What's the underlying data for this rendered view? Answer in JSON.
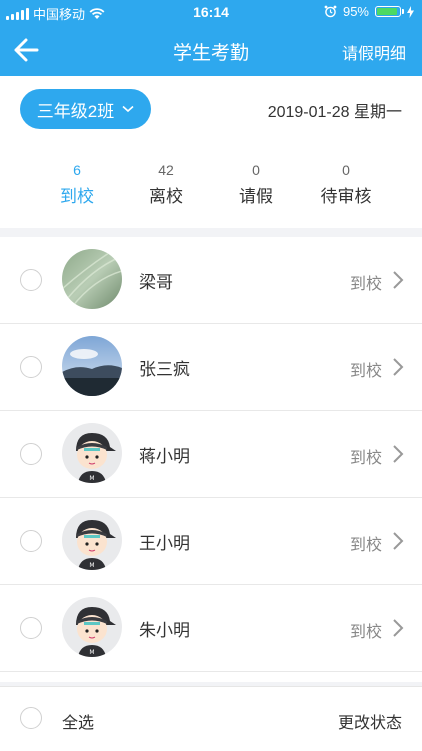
{
  "statusbar": {
    "carrier": "中国移动",
    "time": "16:14",
    "battery": "95%"
  },
  "navbar": {
    "title": "学生考勤",
    "right_link": "请假明细"
  },
  "filter": {
    "class_name": "三年级2班",
    "date": "2019-01-28  星期一"
  },
  "stats": [
    {
      "count": "6",
      "label": "到校",
      "active": true
    },
    {
      "count": "42",
      "label": "离校",
      "active": false
    },
    {
      "count": "0",
      "label": "请假",
      "active": false
    },
    {
      "count": "0",
      "label": "待审核",
      "active": false
    }
  ],
  "students": [
    {
      "name": "梁哥",
      "status": "到校",
      "avatar": "photo-grass"
    },
    {
      "name": "张三疯",
      "status": "到校",
      "avatar": "photo-landscape"
    },
    {
      "name": "蒋小明",
      "status": "到校",
      "avatar": "cartoon-boy"
    },
    {
      "name": "王小明",
      "status": "到校",
      "avatar": "cartoon-boy"
    },
    {
      "name": "朱小明",
      "status": "到校",
      "avatar": "cartoon-boy"
    }
  ],
  "bottom": {
    "select_all": "全选",
    "change_status": "更改状态"
  },
  "colors": {
    "primary": "#2ea8ee",
    "battery": "#4cd964"
  }
}
